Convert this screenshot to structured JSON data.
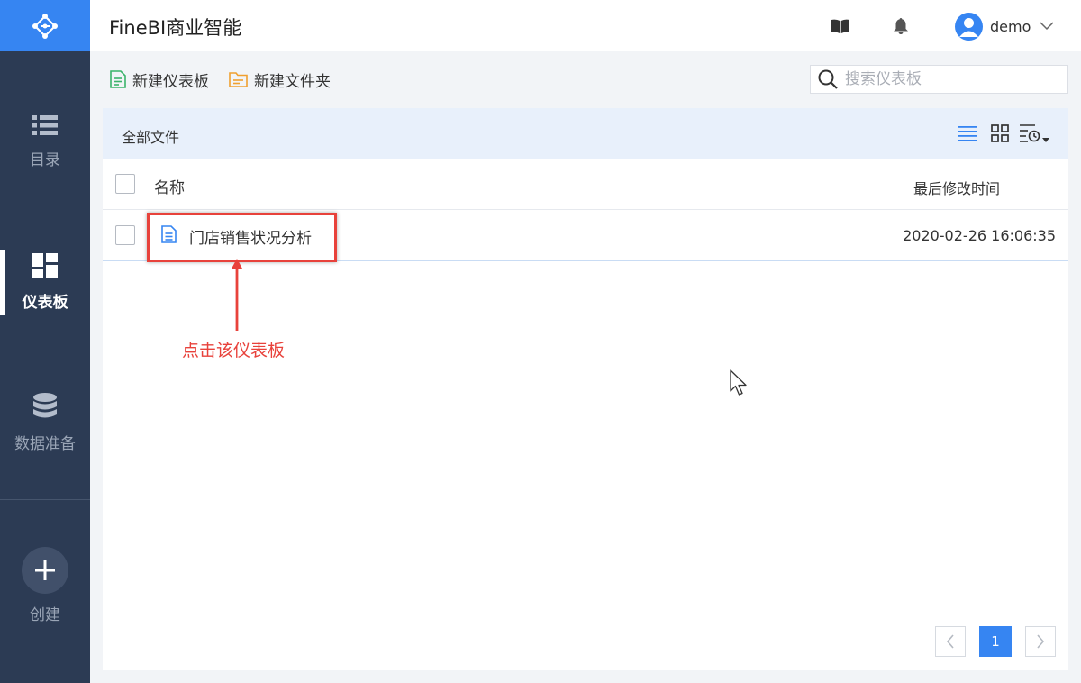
{
  "app": {
    "title": "FineBI商业智能"
  },
  "sidebar": {
    "items": [
      {
        "label": "目录",
        "icon": "list-icon",
        "active": false
      },
      {
        "label": "仪表板",
        "icon": "dashboard-icon",
        "active": true
      },
      {
        "label": "数据准备",
        "icon": "database-icon",
        "active": false
      }
    ],
    "create_label": "创建"
  },
  "header": {
    "user": {
      "name": "demo"
    }
  },
  "toolbar": {
    "new_dashboard_label": "新建仪表板",
    "new_folder_label": "新建文件夹",
    "search_placeholder": "搜索仪表板"
  },
  "main": {
    "breadcrumb": "全部文件",
    "columns": {
      "name": "名称",
      "modified": "最后修改时间"
    },
    "files": [
      {
        "name": "门店销售状况分析",
        "modified": "2020-02-26 16:06:35"
      }
    ],
    "pagination": {
      "current": "1"
    }
  },
  "annotation": {
    "text": "点击该仪表板"
  },
  "colors": {
    "accent": "#3685f2",
    "sidebar_bg": "#2c3b54",
    "annotation_red": "#e8423b"
  }
}
